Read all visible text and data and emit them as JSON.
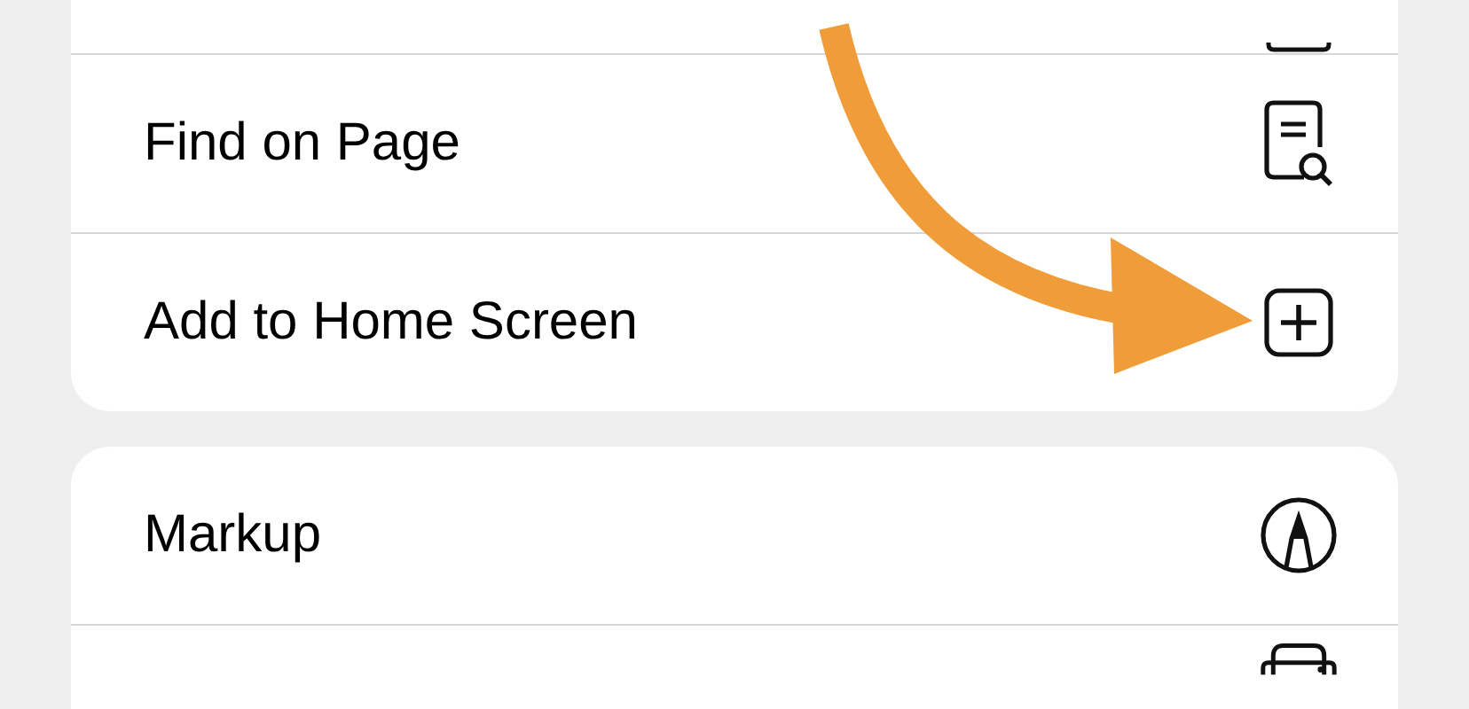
{
  "groups": [
    {
      "items": [
        {
          "kind": "partial"
        },
        {
          "label": "Find on Page",
          "kind": "find"
        },
        {
          "label": "Add to Home Screen",
          "kind": "add"
        }
      ]
    },
    {
      "items": [
        {
          "label": "Markup",
          "kind": "markup"
        },
        {
          "kind": "print"
        }
      ]
    }
  ]
}
